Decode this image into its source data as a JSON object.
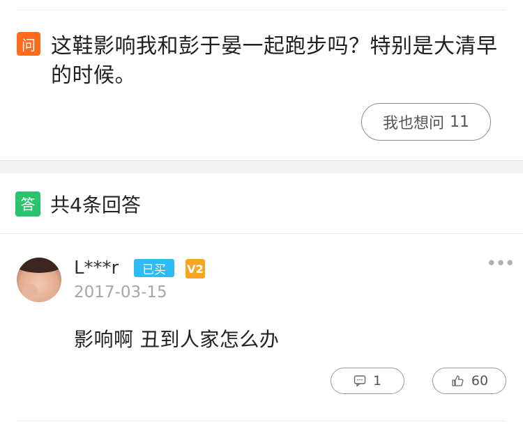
{
  "question": {
    "badge": "问",
    "text": "这鞋影响我和彭于晏一起跑步吗？特别是大清早的时候。",
    "want_label": "我也想问",
    "want_count": "11"
  },
  "answers_header": {
    "badge": "答",
    "title": "共4条回答"
  },
  "answer": {
    "user_name": "L***r",
    "bought_badge": "已买",
    "level_badge": "V2",
    "date": "2017-03-15",
    "text": "影响啊 丑到人家怎么办",
    "comment_count": "1",
    "like_count": "60",
    "more_icon": "more-dots-icon"
  },
  "colors": {
    "question_badge": "#ff6b1a",
    "answer_badge": "#2bc46d",
    "bought_badge": "#2fb9f5",
    "level_badge": "#f6a623"
  }
}
